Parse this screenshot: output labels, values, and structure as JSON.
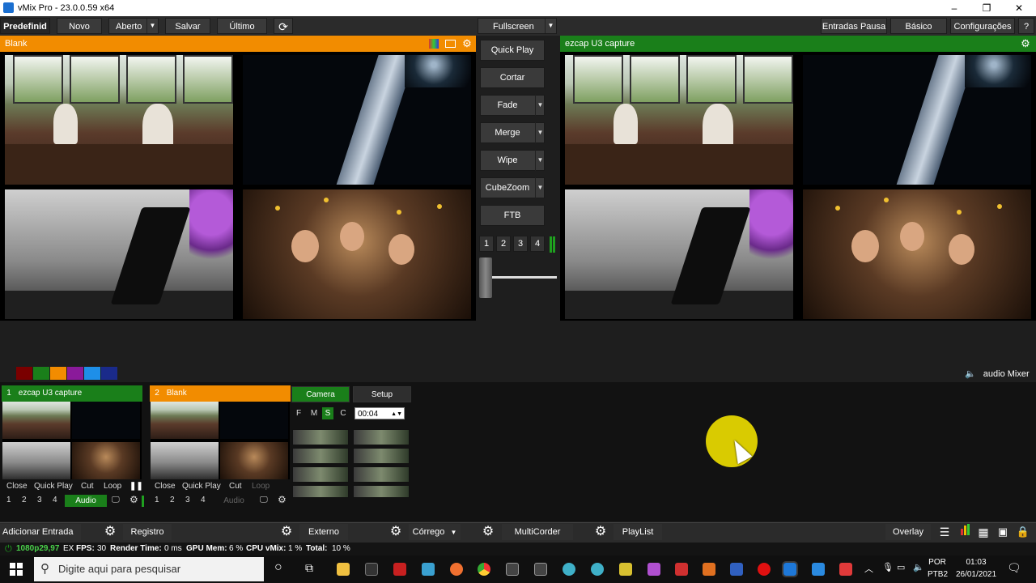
{
  "window": {
    "title": "vMix Pro - 23.0.0.59 x64",
    "minimize": "–",
    "restore": "❐",
    "close": "✕"
  },
  "toolbar": {
    "predefinid": "Predefinid",
    "novo": "Novo",
    "aberto": "Aberto",
    "salvar": "Salvar",
    "ultimo": "Último",
    "fullscreen": "Fullscreen",
    "entradas_pausa": "Entradas Pausa",
    "basico": "Básico",
    "configuracoes": "Configurações",
    "help": "?"
  },
  "preview": {
    "title": "Blank"
  },
  "program": {
    "title": "ezcap U3 capture"
  },
  "transitions": {
    "quick_play": "Quick Play",
    "cortar": "Cortar",
    "fade": "Fade",
    "merge": "Merge",
    "wipe": "Wipe",
    "cubezoom": "CubeZoom",
    "ftb": "FTB",
    "numbers": [
      "1",
      "2",
      "3",
      "4"
    ],
    "tbar_position": 0.1
  },
  "color_swatches": [
    "#7a0000",
    "#1a7f1a",
    "#f28c00",
    "#8a1a9a",
    "#1e8fe8",
    "#1a2a8a"
  ],
  "audio_mixer": {
    "label": "audio Mixer"
  },
  "inputs": [
    {
      "number": "1",
      "name": "ezcap U3 capture",
      "color": "#1a7f1a",
      "buttons": {
        "close": "Close",
        "quick_play": "Quick Play",
        "cut": "Cut",
        "loop": "Loop"
      },
      "nums": [
        "1",
        "2",
        "3",
        "4"
      ],
      "audio": "Audio"
    },
    {
      "number": "2",
      "name": "Blank",
      "color": "#f28c00",
      "buttons": {
        "close": "Close",
        "quick_play": "Quick Play",
        "cut": "Cut",
        "loop": "Loop"
      },
      "nums": [
        "1",
        "2",
        "3",
        "4"
      ],
      "audio": "Audio"
    }
  ],
  "camera_panel": {
    "camera": "Camera",
    "setup": "Setup",
    "modes": [
      "F",
      "M",
      "S",
      "C"
    ],
    "time": "00:04"
  },
  "bottombar": {
    "adicionar_entrada": "Adicionar Entrada",
    "registro": "Registro",
    "externo": "Externo",
    "corrego": "Córrego",
    "multicorder": "MultiCorder",
    "playlist": "PlayList",
    "overlay": "Overlay"
  },
  "status": {
    "resolution": "1080p29,97",
    "ex": "EX",
    "fps_label": "FPS:",
    "fps": "30",
    "render_label": "Render Time:",
    "render": "0 ms",
    "gpu_label": "GPU Mem:",
    "gpu": "6 %",
    "cpu_label": "CPU vMix:",
    "cpu": "1 %",
    "total_label": "Total:",
    "total": "10 %"
  },
  "taskbar": {
    "search_placeholder": "Digite aqui para pesquisar",
    "lang": "POR",
    "layout": "PTB2",
    "time": "01:03",
    "date": "26/01/2021"
  }
}
